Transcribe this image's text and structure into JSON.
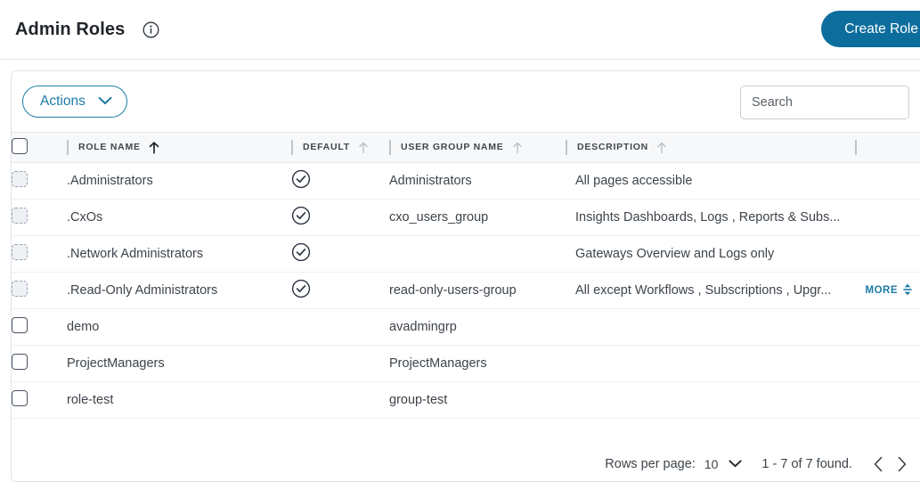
{
  "header": {
    "title": "Admin Roles",
    "info_icon": "info-circle-icon",
    "create_button": "Create Role",
    "accent_color": "#0d6e9e"
  },
  "toolbar": {
    "actions_label": "Actions",
    "actions_chevron": "chevron-down-icon",
    "search_placeholder": "Search",
    "search_value": ""
  },
  "table": {
    "columns": [
      {
        "label": "ROLE NAME",
        "sort": "asc-active"
      },
      {
        "label": "DEFAULT",
        "sort": "asc-inactive"
      },
      {
        "label": "USER GROUP NAME",
        "sort": "asc-inactive"
      },
      {
        "label": "DESCRIPTION",
        "sort": "asc-inactive"
      }
    ],
    "select_all_checked": false,
    "rows": [
      {
        "checkbox_state": "disabled",
        "role_name": ".Administrators",
        "is_default": true,
        "user_group_name": "Administrators",
        "description": "All pages accessible",
        "more": ""
      },
      {
        "checkbox_state": "disabled",
        "role_name": ".CxOs",
        "is_default": true,
        "user_group_name": "cxo_users_group",
        "description": "Insights Dashboards, Logs , Reports & Subs...",
        "more": ""
      },
      {
        "checkbox_state": "disabled",
        "role_name": ".Network Administrators",
        "is_default": true,
        "user_group_name": "",
        "description": "Gateways Overview and Logs only",
        "more": ""
      },
      {
        "checkbox_state": "disabled",
        "role_name": ".Read-Only Administrators",
        "is_default": true,
        "user_group_name": "read-only-users-group",
        "description": "All except Workflows , Subscriptions , Upgr...",
        "more": "MORE"
      },
      {
        "checkbox_state": "enabled",
        "role_name": "demo",
        "is_default": false,
        "user_group_name": "avadmingrp",
        "description": "",
        "more": ""
      },
      {
        "checkbox_state": "enabled",
        "role_name": "ProjectManagers",
        "is_default": false,
        "user_group_name": "ProjectManagers",
        "description": "",
        "more": ""
      },
      {
        "checkbox_state": "enabled",
        "role_name": "role-test",
        "is_default": false,
        "user_group_name": "group-test",
        "description": "",
        "more": ""
      }
    ]
  },
  "pagination": {
    "rows_per_page_label": "Rows per page:",
    "rows_per_page_value": "10",
    "rows_chevron": "chevron-down-icon",
    "found_text": "1 - 7 of 7 found.",
    "prev_icon": "chevron-left-icon",
    "next_icon": "chevron-right-icon"
  }
}
